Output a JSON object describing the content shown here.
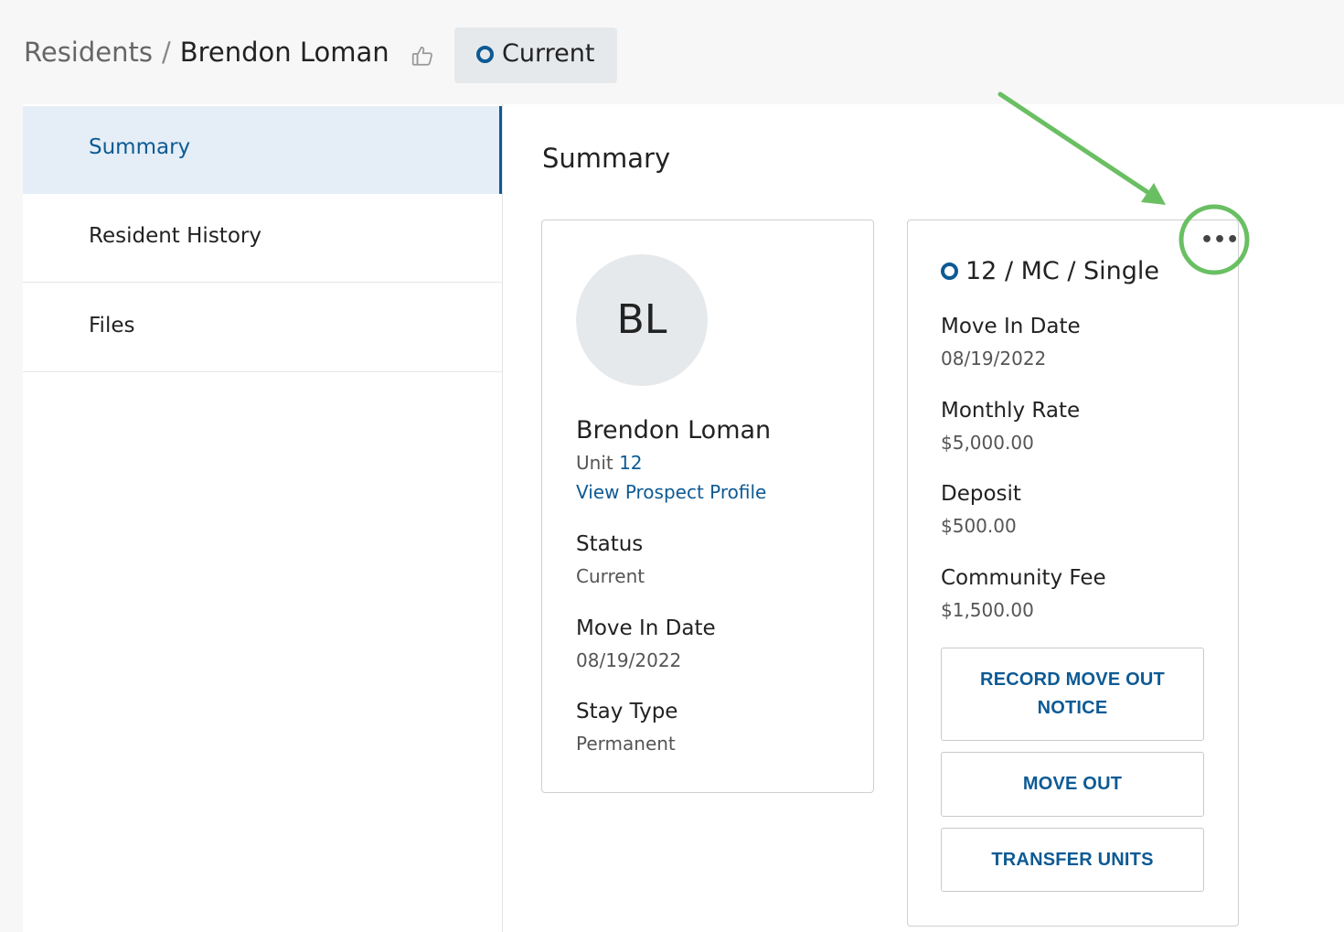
{
  "breadcrumb": {
    "parent": "Residents",
    "separator": "/",
    "current": "Brendon Loman"
  },
  "status_pill": {
    "label": "Current"
  },
  "sidebar": {
    "items": [
      {
        "label": "Summary",
        "active": true
      },
      {
        "label": "Resident History",
        "active": false
      },
      {
        "label": "Files",
        "active": false
      }
    ]
  },
  "main": {
    "title": "Summary"
  },
  "profile_card": {
    "initials": "BL",
    "name": "Brendon Loman",
    "unit_prefix": "Unit",
    "unit_number": "12",
    "prospect_link": "View Prospect Profile",
    "status_label": "Status",
    "status_value": "Current",
    "move_in_label": "Move In Date",
    "move_in_value": "08/19/2022",
    "stay_type_label": "Stay Type",
    "stay_type_value": "Permanent"
  },
  "unit_card": {
    "title": "12 / MC / Single",
    "more_icon": "more-horizontal-icon",
    "fields": [
      {
        "label": "Move In Date",
        "value": "08/19/2022"
      },
      {
        "label": "Monthly Rate",
        "value": "$5,000.00"
      },
      {
        "label": "Deposit",
        "value": "$500.00"
      },
      {
        "label": "Community Fee",
        "value": "$1,500.00"
      }
    ],
    "buttons": {
      "record_move_out_line1": "RECORD MOVE OUT",
      "record_move_out_line2": "NOTICE",
      "move_out": "MOVE OUT",
      "transfer_units": "TRANSFER UNITS"
    }
  },
  "colors": {
    "accent": "#0d5a94",
    "annotation": "#6abf63",
    "active_nav_bg": "#e5eef6",
    "pill_bg": "#e6e9ec"
  }
}
